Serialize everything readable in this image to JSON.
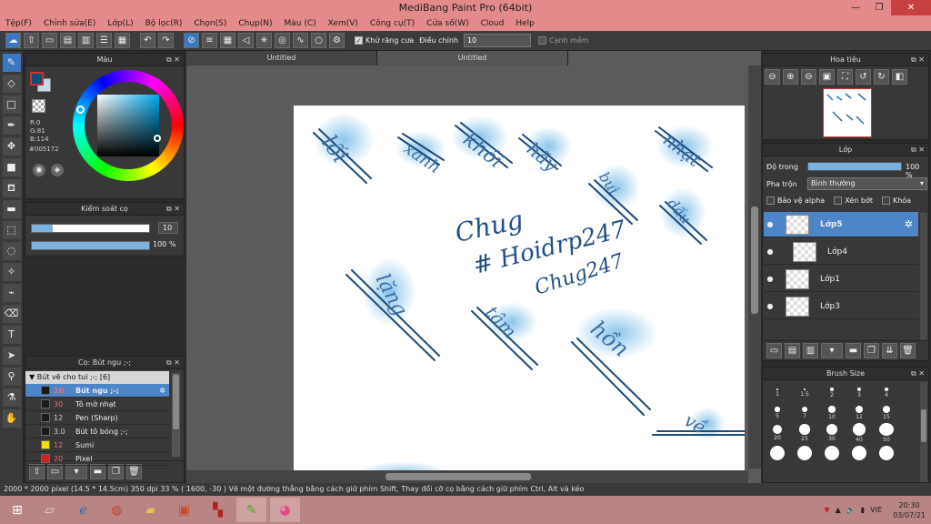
{
  "app": {
    "title": "MediBang Paint Pro (64bit)"
  },
  "window_controls": {
    "minimize": "—",
    "restore": "❐",
    "close": "✕"
  },
  "menu": [
    "Tệp(F)",
    "Chỉnh sửa(E)",
    "Lớp(L)",
    "Bộ lọc(R)",
    "Chọn(S)",
    "Chụp(N)",
    "Màu (C)",
    "Xem(V)",
    "Công cụ(T)",
    "Cửa số(W)",
    "Cloud",
    "Help"
  ],
  "toolbar": {
    "antialias_label": "Khử răng cưa",
    "antialias_checked": true,
    "correction_label": "Điều chỉnh",
    "correction_value": "10",
    "edge_label": "Cạnh mềm",
    "edge_checked": false
  },
  "color_panel": {
    "title": "Màu",
    "r": "R:0",
    "g": "G:81",
    "b": "B:114",
    "hex": "#005172",
    "fg_color": "#005172",
    "bg_color": "#c6d9ef"
  },
  "brush_control": {
    "title": "Kiểm soát cọ",
    "size_value": "10",
    "size_fraction": 0.18,
    "opacity_value": "100 %",
    "opacity_fraction": 1.0
  },
  "brush_panel": {
    "title": "Cọ: Bút ngu ;-;",
    "group": "Bút vẽ cho tui ;-; [6]",
    "items": [
      {
        "size": "10",
        "name": "Bút ngu ;-;",
        "swatch": "#1a1a1a",
        "selected": true
      },
      {
        "size": "30",
        "name": "Tô mờ nhạt",
        "swatch": "#1a1a1a",
        "selected": false
      },
      {
        "size": "12",
        "name": "Pen (Sharp)",
        "swatch": "#1a1a1a",
        "selected": false
      },
      {
        "size": "3.0",
        "name": "Bút tô bóng ;-;",
        "swatch": "#1a1a1a",
        "selected": false
      },
      {
        "size": "12",
        "name": "Sumi",
        "swatch": "#f0e000",
        "selected": false
      },
      {
        "size": "20",
        "name": "Pixel",
        "swatch": "#d02020",
        "selected": false
      }
    ]
  },
  "document_tabs": [
    "Untitled",
    "Untitled"
  ],
  "canvas": {
    "writings": [
      {
        "text": "Chug",
        "color": "#1f4f86"
      },
      {
        "text": "# Hoidrp247",
        "color": "#1f4f86"
      },
      {
        "text": "Chug247",
        "color": "#1f4f86"
      },
      {
        "text": "lối",
        "color": "#3c6fa6"
      },
      {
        "text": "xanh",
        "color": "#3c6fa6"
      },
      {
        "text": "khói",
        "color": "#3c6fa6"
      },
      {
        "text": "hãy",
        "color": "#3c6fa6"
      },
      {
        "text": "nhạt",
        "color": "#3c6fa6"
      },
      {
        "text": "bụi",
        "color": "#3c6fa6"
      },
      {
        "text": "dấu",
        "color": "#3c6fa6"
      },
      {
        "text": "lặng",
        "color": "#3c6fa6"
      },
      {
        "text": "tâm",
        "color": "#3c6fa6"
      },
      {
        "text": "hồn",
        "color": "#3c6fa6"
      },
      {
        "text": "về",
        "color": "#3c6fa6"
      }
    ]
  },
  "navigator": {
    "title": "Hoa tiêu"
  },
  "layers": {
    "title": "Lớp",
    "opacity_label": "Độ trong",
    "opacity_value": "100 %",
    "opacity_fraction": 1.0,
    "blend_label": "Pha trộn",
    "blend_value": "Bình thường",
    "protect_alpha": "Bảo vệ alpha",
    "clipping": "Xén bớt",
    "lock": "Khóa",
    "items": [
      {
        "name": "Lớp5",
        "selected": true,
        "visible": true,
        "indent": false
      },
      {
        "name": "Lớp4",
        "selected": false,
        "visible": true,
        "indent": true
      },
      {
        "name": "Lớp1",
        "selected": false,
        "visible": true,
        "indent": false
      },
      {
        "name": "Lớp3",
        "selected": false,
        "visible": true,
        "indent": false
      }
    ]
  },
  "brush_size": {
    "title": "Brush Size",
    "sizes": [
      "1",
      "1.5",
      "2",
      "3",
      "4",
      "5",
      "7",
      "10",
      "12",
      "15",
      "20",
      "25",
      "30",
      "40",
      "50",
      "",
      "",
      "",
      "",
      ""
    ]
  },
  "status": {
    "text": "2000 * 2000 pixel   (14.5 * 14.5cm)   350 dpi   33 %   ( 1600, -30 )   Vẽ một đường thẳng bằng cách giữ phím Shift, Thay đổi cỡ cọ bằng cách giữ phím Ctrl, Alt và kéo"
  },
  "taskbar": {
    "clock_time": "20:30",
    "clock_date": "03/07/21",
    "language": "VIE",
    "apps": [
      "windows-logo",
      "bluestacks",
      "internet-explorer",
      "chrome",
      "file-explorer",
      "powerpoint",
      "paint-app",
      "lightshot",
      "medibang"
    ]
  }
}
